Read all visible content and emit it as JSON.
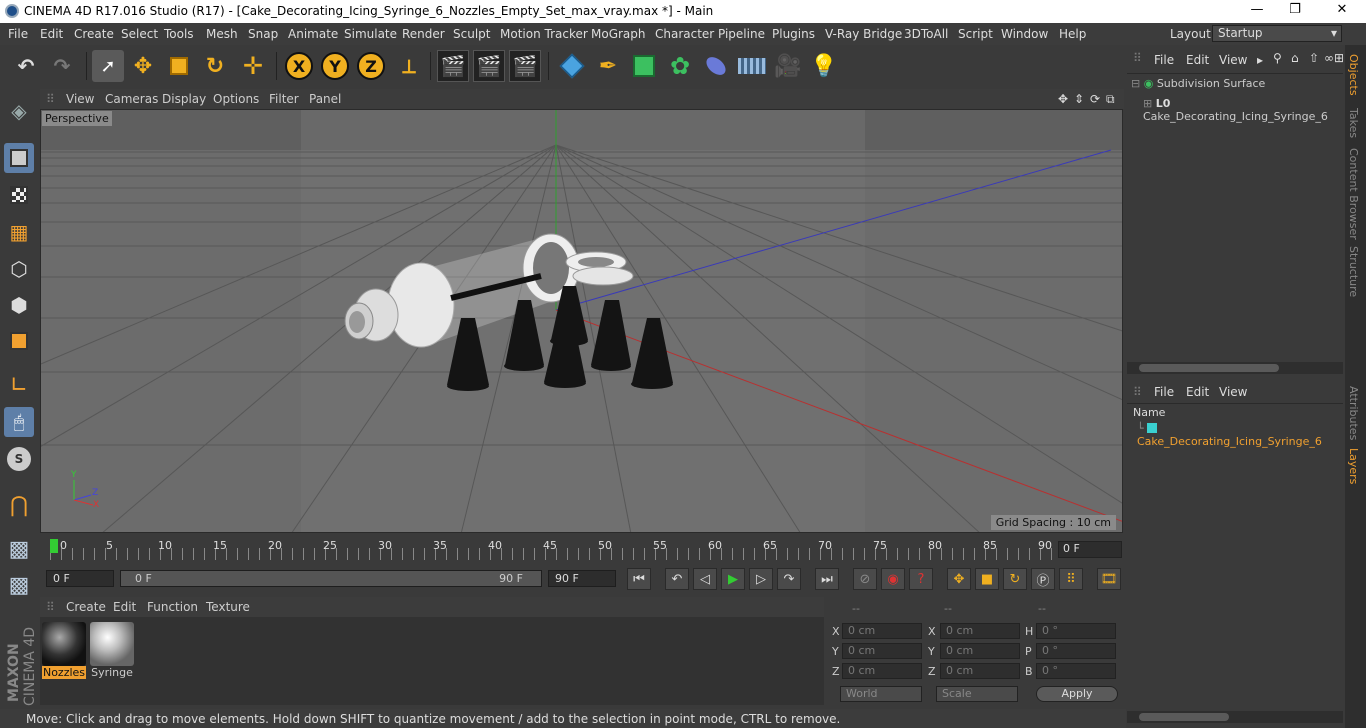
{
  "window": {
    "title": "CINEMA 4D R17.016 Studio (R17) - [Cake_Decorating_Icing_Syringe_6_Nozzles_Empty_Set_max_vray.max *] - Main",
    "minimize": "—",
    "maximize": "❐",
    "close": "✕"
  },
  "menu": {
    "items": [
      "File",
      "Edit",
      "Create",
      "Select",
      "Tools",
      "Mesh",
      "Snap",
      "Animate",
      "Simulate",
      "Render",
      "Sculpt",
      "Motion Tracker",
      "MoGraph",
      "Character",
      "Pipeline",
      "Plugins",
      "V-Ray Bridge",
      "3DToAll",
      "Script",
      "Window",
      "Help"
    ],
    "layout_label": "Layout:",
    "layout_value": "Startup"
  },
  "toolbar": {
    "undo_icon": "undo-icon",
    "axis_x": "X",
    "axis_y": "Y",
    "axis_z": "Z"
  },
  "viewport": {
    "menu": [
      "View",
      "Cameras",
      "Display",
      "Options",
      "Filter",
      "Panel"
    ],
    "camera_label": "Perspective",
    "grid_spacing": "Grid Spacing : 10 cm",
    "axis_x": "X",
    "axis_y": "Y",
    "axis_z": "Z"
  },
  "timeline": {
    "ticks": [
      "0",
      "5",
      "10",
      "15",
      "20",
      "25",
      "30",
      "35",
      "40",
      "45",
      "50",
      "55",
      "60",
      "65",
      "70",
      "75",
      "80",
      "85",
      "90"
    ],
    "frame_end_field": "0 F",
    "start_field": "0 F",
    "range_start": "0 F",
    "range_end": "90 F",
    "end_field": "90 F",
    "current_frame": 0
  },
  "materials": {
    "menu": [
      "Create",
      "Edit",
      "Function",
      "Texture"
    ],
    "items": [
      {
        "name": "Nozzles",
        "selected": true
      },
      {
        "name": "Syringe",
        "selected": false
      }
    ]
  },
  "coordinates": {
    "headers": [
      "--",
      "--",
      "--"
    ],
    "rows": [
      {
        "a": "X",
        "av": "0 cm",
        "b": "X",
        "bv": "0 cm",
        "c": "H",
        "cv": "0 °"
      },
      {
        "a": "Y",
        "av": "0 cm",
        "b": "Y",
        "bv": "0 cm",
        "c": "P",
        "cv": "0 °"
      },
      {
        "a": "Z",
        "av": "0 cm",
        "b": "Z",
        "bv": "0 cm",
        "c": "B",
        "cv": "0 °"
      }
    ],
    "world": "World",
    "scale": "Scale",
    "apply": "Apply"
  },
  "objects_panel": {
    "menu": [
      "File",
      "Edit",
      "View"
    ],
    "items": [
      "Subdivision Surface",
      "Cake_Decorating_Icing_Syringe_6"
    ]
  },
  "layers_panel": {
    "menu": [
      "File",
      "Edit",
      "View"
    ],
    "column": "Name",
    "items": [
      "Cake_Decorating_Icing_Syringe_6"
    ],
    "accent": "#f0a030"
  },
  "side_tabs": [
    "Objects",
    "Takes",
    "Content Browser",
    "Structure",
    "Attributes",
    "Layers"
  ],
  "status": "Move: Click and drag to move elements. Hold down SHIFT to quantize movement / add to the selection in point mode, CTRL to remove.",
  "brand": {
    "line1": "MAXON",
    "line2": "CINEMA 4D"
  }
}
